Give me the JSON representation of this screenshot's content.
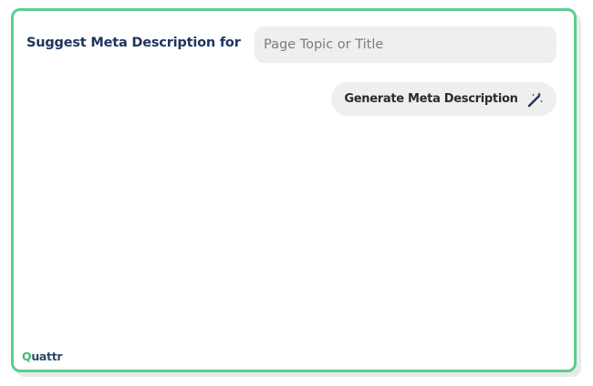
{
  "form": {
    "label": "Suggest Meta Description for",
    "input": {
      "placeholder": "Page Topic or Title",
      "value": ""
    },
    "generate_button": {
      "label": "Generate Meta Description",
      "icon": "magic-wand-icon"
    }
  },
  "brand": {
    "logo_first": "Q",
    "logo_rest": "uattr"
  },
  "colors": {
    "border": "#5ccd8f",
    "label": "#1f3560",
    "field_bg": "#efefef",
    "logo_green": "#3cb878"
  }
}
